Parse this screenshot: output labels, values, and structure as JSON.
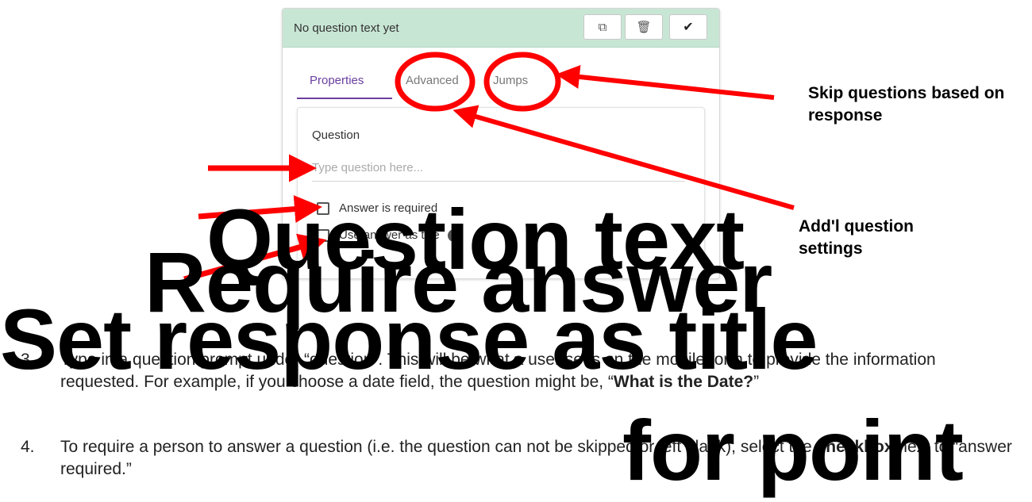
{
  "card": {
    "title": "No question text yet",
    "header_buttons": [
      "copy-icon",
      "trash-icon",
      "check-icon"
    ],
    "tabs": [
      {
        "label": "Properties",
        "active": true
      },
      {
        "label": "Advanced",
        "active": false
      },
      {
        "label": "Jumps",
        "active": false
      }
    ],
    "question_label": "Question",
    "question_placeholder": "Type question here...",
    "checkbox_required": "Answer is required",
    "checkbox_title": "Use answer as title",
    "accent_color": "#6b3fa0",
    "header_color": "#c8e6d4"
  },
  "notes": {
    "skip": "Skip questions based on response",
    "addl": "Add'l question settings"
  },
  "overlay": {
    "line1": "Question text",
    "line2": "Require answer",
    "line3": "Set response as title",
    "line4": "for point"
  },
  "paragraphs": {
    "p3_num": "3.",
    "p3_a": "Type in a question prompt under “question”. This will be what a user sees on the mobile form to provide the information requested. For example, if you choose a date field, the question might be, “",
    "p3_bold": "What is the Date?",
    "p3_b": "”",
    "p4_num": "4.",
    "p4_a": "To require a person to answer a question (i.e. the question can not be skipped or left blank), select the ",
    "p4_bold": "checkbox",
    "p4_b": " next to “answer required.”"
  },
  "annotation_color": "#ff0000"
}
